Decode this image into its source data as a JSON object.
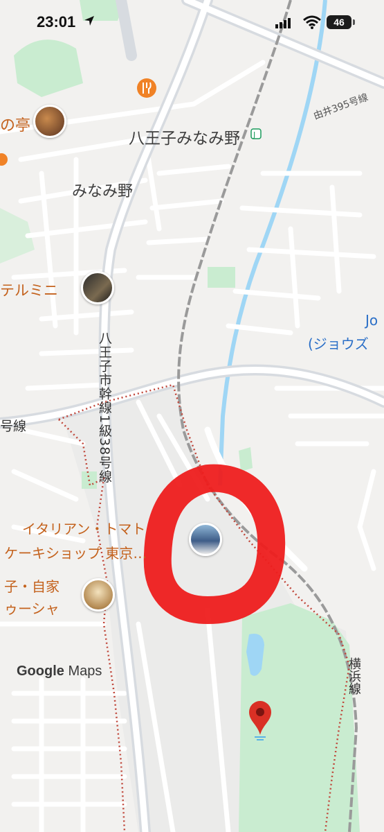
{
  "status_bar": {
    "time": "23:01",
    "battery": "46"
  },
  "labels": {
    "station": "八王子みなみ野",
    "area": "みなみ野",
    "road_395": "由井395号線",
    "road_38": "八王子市幹線1級38号線",
    "road_left": "号線",
    "yokohama_line": "横浜線",
    "jo_partial": "Jo",
    "jo_kana_partial": "(ジョウズ",
    "restaurant_partial": "の亭",
    "hotel_partial": "テルミニ",
    "italian_line1": "イタリアン・トマト",
    "italian_line2": "ケーキショップ 東京…",
    "bakery_line1": "子・自家",
    "bakery_line2": "ゥーシャ"
  },
  "branding": {
    "logo_google": "Google",
    "logo_maps": "Maps"
  },
  "colors": {
    "map_bg": "#f2f1ef",
    "road": "#ffffff",
    "major_road": "#d7dbe0",
    "park": "#c9ecd0",
    "water": "#9fd6f5",
    "rail": "#9a9a9a",
    "boundary": "#c0463a",
    "annotation_red": "#ee1d1d",
    "poi_orange": "#f08226",
    "pin_red": "#d93025"
  },
  "icons": [
    "location-arrow-icon",
    "signal-icon",
    "wifi-icon",
    "fork-knife-icon",
    "train-station-icon",
    "red-map-pin-icon"
  ]
}
